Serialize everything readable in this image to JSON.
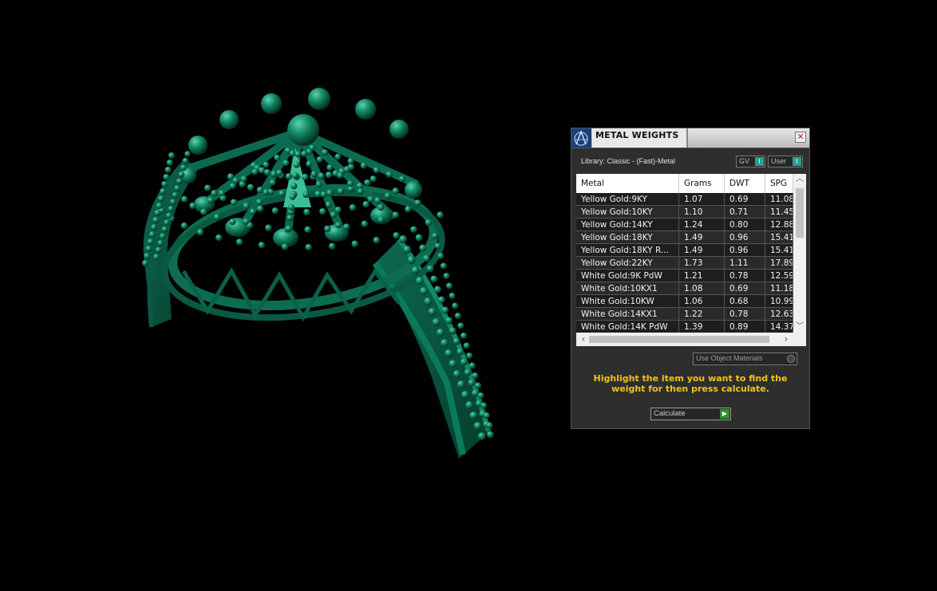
{
  "viewport": {
    "background": "#000000",
    "model": "ring-3d-model",
    "model_color": "#0f5a44"
  },
  "panel": {
    "title": "METAL WEIGHTS",
    "close_glyph": "✕",
    "app_icon": "metal-weights-app-icon",
    "library_label": "Library: Classic - (Fast)-Metal",
    "toggles": {
      "gv_label": "GV",
      "user_label": "User",
      "knob_glyph": "I"
    },
    "table": {
      "headers": [
        "Metal",
        "Grams",
        "DWT",
        "SPG"
      ],
      "rows": [
        [
          "Yellow Gold:9KY",
          "1.07",
          "0.69",
          "11.08"
        ],
        [
          "Yellow Gold:10KY",
          "1.10",
          "0.71",
          "11.45"
        ],
        [
          "Yellow Gold:14KY",
          "1.24",
          "0.80",
          "12.88"
        ],
        [
          "Yellow Gold:18KY",
          "1.49",
          "0.96",
          "15.41"
        ],
        [
          "Yellow Gold:18KY R...",
          "1.49",
          "0.96",
          "15.41"
        ],
        [
          "Yellow Gold:22KY",
          "1.73",
          "1.11",
          "17.89"
        ],
        [
          "White Gold:9K PdW",
          "1.21",
          "0.78",
          "12.59"
        ],
        [
          "White Gold:10KX1",
          "1.08",
          "0.69",
          "11.18"
        ],
        [
          "White Gold:10KW",
          "1.06",
          "0.68",
          "10.99"
        ],
        [
          "White Gold:14KX1",
          "1.22",
          "0.78",
          "12.63"
        ],
        [
          "White Gold:14K PdW",
          "1.39",
          "0.89",
          "14.37"
        ]
      ]
    },
    "use_object_materials_label": "Use Object Materials",
    "hint": "Highlight the item you want to find the weight for then press calculate.",
    "calculate_label": "Calculate",
    "colors": {
      "panel_bg": "#2e2e2e",
      "accent_teal": "#2aa090",
      "hint_yellow": "#f0c419",
      "calc_green": "#2f8f2f"
    }
  }
}
